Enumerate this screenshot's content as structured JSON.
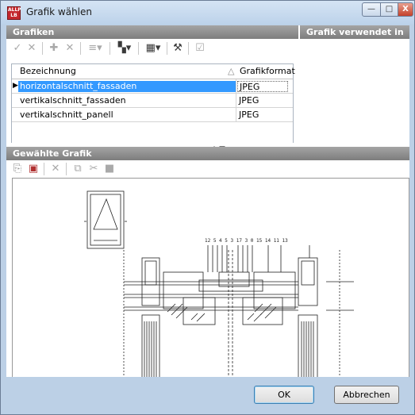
{
  "window": {
    "title": "Grafik wählen",
    "icon": "allplan-lb-icon",
    "min_label": "—",
    "max_label": "□",
    "close_label": "X"
  },
  "sections": {
    "grafiken": "Grafiken",
    "verwendet_in": "Grafik verwendet in",
    "gewaehlte": "Gewählte Grafik"
  },
  "grid": {
    "columns": [
      "Bezeichnung",
      "Grafikformat"
    ],
    "sort_indicator": "△",
    "rows": [
      {
        "name": "horizontalschnitt_fassaden",
        "format": "JPEG",
        "selected": true
      },
      {
        "name": "vertikalschnitt_fassaden",
        "format": "JPEG",
        "selected": false
      },
      {
        "name": "vertikalschnitt_panell",
        "format": "JPEG",
        "selected": false
      }
    ]
  },
  "drawing": {
    "labels": "12 5 4 5 3   17 3 0 15   14  11     13"
  },
  "footer": {
    "ok": "OK",
    "cancel": "Abbrechen"
  }
}
